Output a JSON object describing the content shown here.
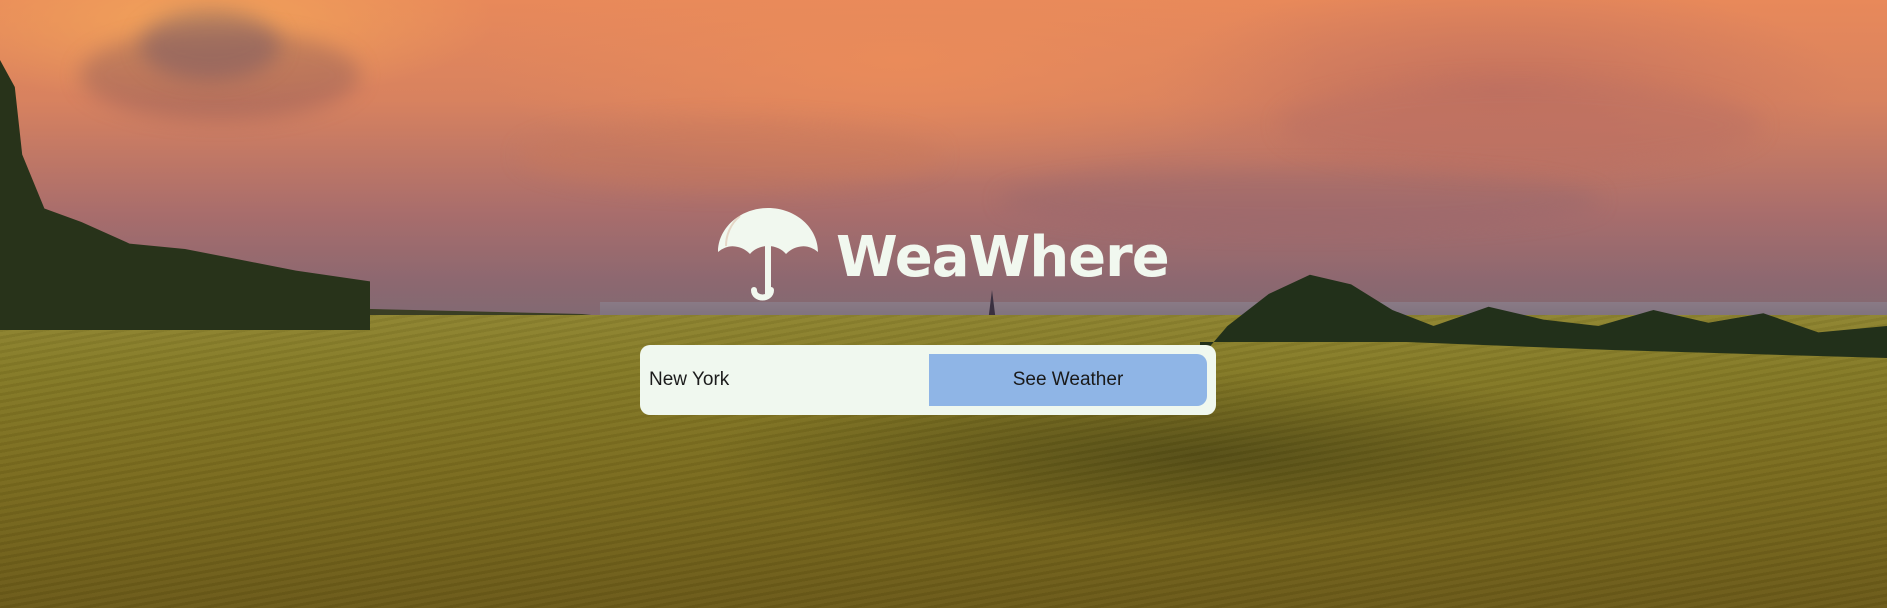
{
  "app": {
    "name": "WeaWhere",
    "logo_icon": "umbrella-icon"
  },
  "search": {
    "value": "New York",
    "button_label": "See Weather"
  },
  "colors": {
    "brand_text": "#f1f8ef",
    "search_box_bg": "#f0f8ef",
    "button_bg": "#8fb5e6"
  },
  "background": {
    "description_icon": "sunset-field-landscape-image"
  }
}
